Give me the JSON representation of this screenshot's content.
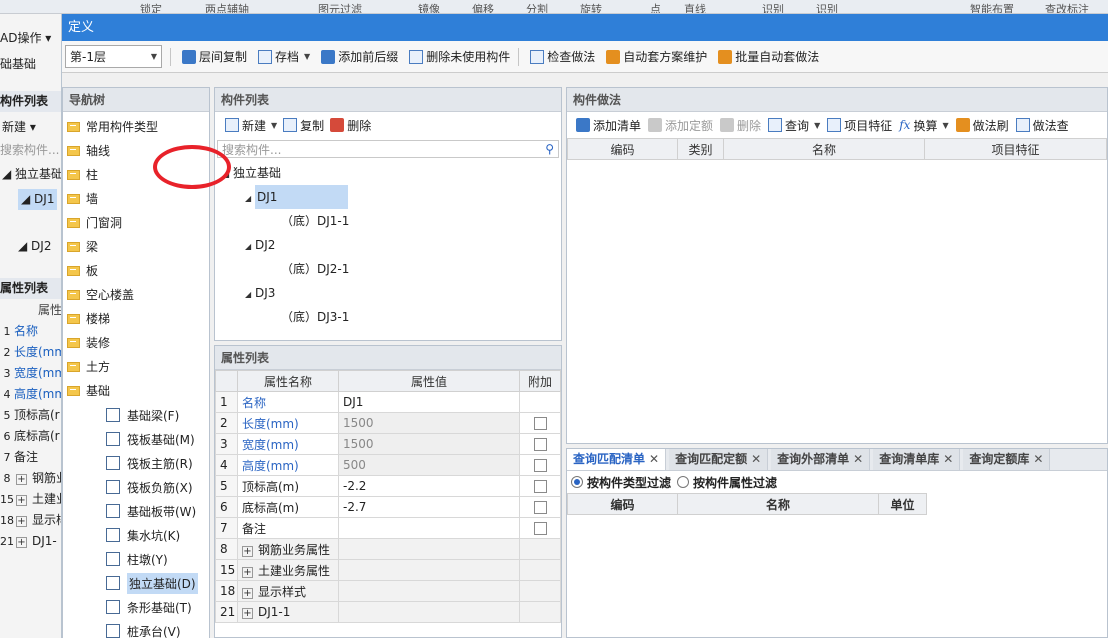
{
  "background": {
    "ribbon": [
      "锁定",
      "两点辅轴",
      "图元过滤",
      "镜像",
      "偏移",
      "分割",
      "旋转",
      "点",
      "直线",
      "识别",
      "识别",
      "智能布置",
      "查改标注"
    ],
    "left": {
      "cad_ops": "AD操作",
      "base": "础基础",
      "comp_list": "构件列表",
      "new": "新建",
      "search": "搜索构件...",
      "tree": [
        "独立基础",
        "DJ1",
        "DJ2"
      ],
      "prop_list": "属性列表",
      "prop_header": "属性",
      "rows": [
        {
          "idx": "1",
          "name": "名称"
        },
        {
          "idx": "2",
          "name": "长度(mm"
        },
        {
          "idx": "3",
          "name": "宽度(mm"
        },
        {
          "idx": "4",
          "name": "高度(mm"
        },
        {
          "idx": "5",
          "name": "顶标高(r"
        },
        {
          "idx": "6",
          "name": "底标高(r"
        },
        {
          "idx": "7",
          "name": "备注"
        },
        {
          "idx": "8",
          "name": "钢筋业"
        },
        {
          "idx": "15",
          "name": "土建业"
        },
        {
          "idx": "18",
          "name": "显示样"
        },
        {
          "idx": "21",
          "name": "DJ1-"
        }
      ]
    }
  },
  "dialog": {
    "title": "定义",
    "toolbar": {
      "floor": "第-1层",
      "buttons": [
        "层间复制",
        "存档",
        "添加前后缀",
        "删除未使用构件",
        "检查做法",
        "自动套方案维护",
        "批量自动套做法"
      ]
    },
    "nav": {
      "header": "导航树",
      "items": [
        "常用构件类型",
        "轴线",
        "柱",
        "墙",
        "门窗洞",
        "梁",
        "板",
        "空心楼盖",
        "楼梯",
        "装修",
        "土方",
        "基础"
      ],
      "sub_items": [
        "基础梁(F)",
        "筏板基础(M)",
        "筏板主筋(R)",
        "筏板负筋(X)",
        "基础板带(W)",
        "集水坑(K)",
        "柱墩(Y)",
        "独立基础(D)",
        "条形基础(T)",
        "桩承台(V)"
      ]
    },
    "components": {
      "header": "构件列表",
      "new": "新建",
      "copy": "复制",
      "delete": "删除",
      "search_placeholder": "搜索构件...",
      "tree": {
        "root": "独立基础",
        "nodes": [
          {
            "name": "DJ1",
            "child": "（底）DJ1-1"
          },
          {
            "name": "DJ2",
            "child": "（底）DJ2-1"
          },
          {
            "name": "DJ3",
            "child": "（底）DJ3-1"
          }
        ]
      }
    },
    "properties": {
      "header": "属性列表",
      "columns": [
        "属性名称",
        "属性值",
        "附加"
      ],
      "rows": [
        {
          "idx": "1",
          "name": "名称",
          "value": "DJ1"
        },
        {
          "idx": "2",
          "name": "长度(mm)",
          "value": "1500"
        },
        {
          "idx": "3",
          "name": "宽度(mm)",
          "value": "1500"
        },
        {
          "idx": "4",
          "name": "高度(mm)",
          "value": "500"
        },
        {
          "idx": "5",
          "name": "顶标高(m)",
          "value": "-2.2"
        },
        {
          "idx": "6",
          "name": "底标高(m)",
          "value": "-2.7"
        },
        {
          "idx": "7",
          "name": "备注",
          "value": ""
        },
        {
          "idx": "8",
          "name": "钢筋业务属性"
        },
        {
          "idx": "15",
          "name": "土建业务属性"
        },
        {
          "idx": "18",
          "name": "显示样式"
        },
        {
          "idx": "21",
          "name": "DJ1-1"
        }
      ]
    },
    "method": {
      "header": "构件做法",
      "toolbar": [
        "添加清单",
        "添加定额",
        "删除",
        "查询",
        "项目特征",
        "换算",
        "做法刷",
        "做法查"
      ],
      "columns": [
        "编码",
        "类别",
        "名称",
        "项目特征"
      ]
    },
    "query": {
      "tabs": [
        "查询匹配清单",
        "查询匹配定额",
        "查询外部清单",
        "查询清单库",
        "查询定额库"
      ],
      "filters": [
        "按构件类型过滤",
        "按构件属性过滤"
      ],
      "columns": [
        "编码",
        "名称",
        "单位"
      ]
    }
  }
}
